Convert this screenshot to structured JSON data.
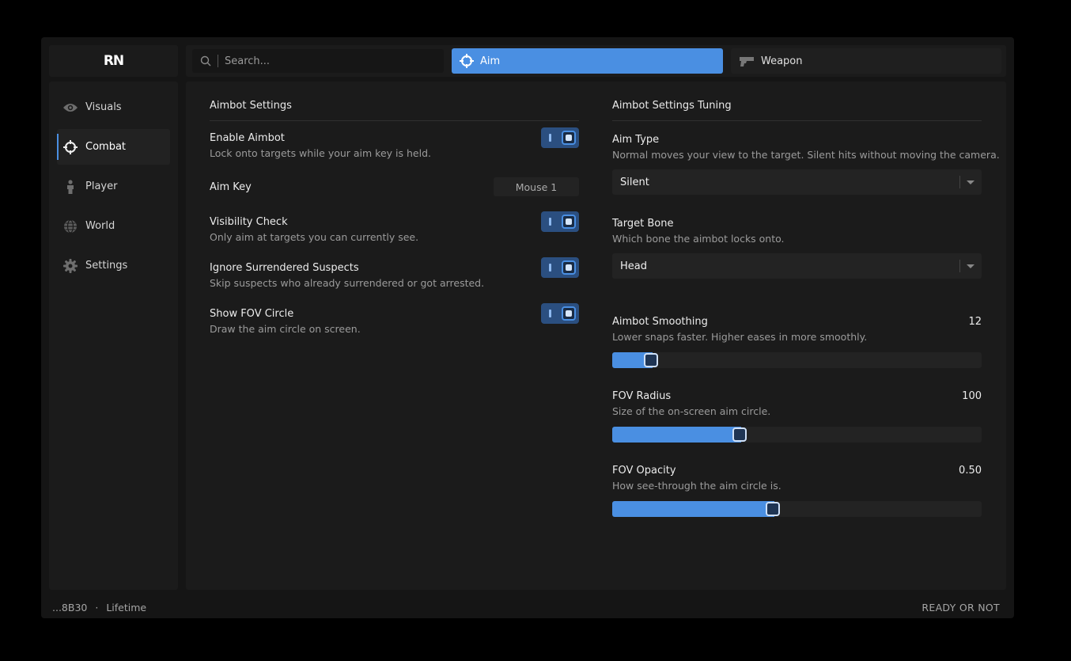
{
  "brand": {
    "logo_text": "RN"
  },
  "search": {
    "placeholder": "Search..."
  },
  "tabs": [
    {
      "label": "Aim",
      "icon": "crosshair-icon",
      "active": true
    },
    {
      "label": "Weapon",
      "icon": "pistol-icon",
      "active": false
    }
  ],
  "sidebar": {
    "items": [
      {
        "label": "Visuals",
        "icon": "eye-icon"
      },
      {
        "label": "Combat",
        "icon": "crosshair-icon",
        "active": true
      },
      {
        "label": "Player",
        "icon": "person-icon"
      },
      {
        "label": "World",
        "icon": "globe-icon"
      },
      {
        "label": "Settings",
        "icon": "gear-icon"
      }
    ]
  },
  "left_panel": {
    "title": "Aimbot Settings",
    "rows": [
      {
        "label": "Enable Aimbot",
        "desc": "Lock onto targets while your aim key is held.",
        "enabled": true
      },
      {
        "label": "Aim Key",
        "key": "Mouse 1"
      },
      {
        "label": "Visibility Check",
        "desc": "Only aim at targets you can currently see.",
        "enabled": true
      },
      {
        "label": "Ignore Surrendered Suspects",
        "desc": "Skip suspects who already surrendered or got arrested.",
        "enabled": true
      },
      {
        "label": "Show FOV Circle",
        "desc": "Draw the aim circle on screen.",
        "enabled": true
      }
    ]
  },
  "right_panel": {
    "title": "Aimbot Settings Tuning",
    "aim_type": {
      "label": "Aim Type",
      "desc": "Normal moves your view to the target. Silent hits without moving the camera.",
      "value": "Silent"
    },
    "target_bone": {
      "label": "Target Bone",
      "desc": "Which bone the aimbot locks onto.",
      "value": "Head"
    },
    "sliders": [
      {
        "label": "Aimbot Smoothing",
        "desc": "Lower snaps faster. Higher eases in more smoothly.",
        "value_text": "12",
        "fraction": 0.09
      },
      {
        "label": "FOV Radius",
        "desc": "Size of the on-screen aim circle.",
        "value_text": "100",
        "fraction": 0.33
      },
      {
        "label": "FOV Opacity",
        "desc": "How see-through the aim circle is.",
        "value_text": "0.50",
        "fraction": 0.42
      }
    ]
  },
  "footer": {
    "id": "...8B30",
    "separator": "·",
    "license": "Lifetime",
    "game": "READY OR NOT"
  },
  "colors": {
    "accent": "#4a8fe2",
    "background": "#151515",
    "panel": "#1b1b1b"
  }
}
